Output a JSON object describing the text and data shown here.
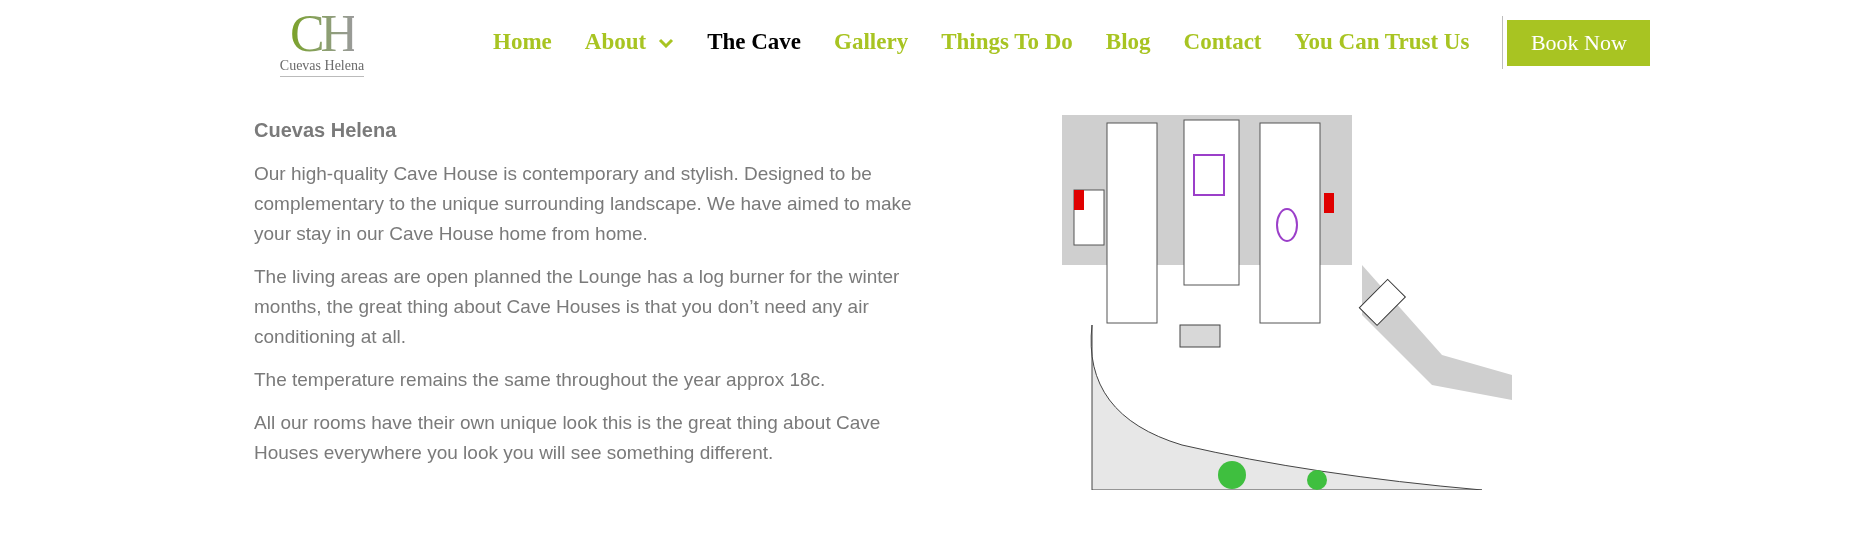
{
  "logo": {
    "initials": "CH",
    "name": "Cuevas Helena"
  },
  "nav": [
    {
      "label": "Home",
      "selected": false,
      "dropdown": false
    },
    {
      "label": "About",
      "selected": false,
      "dropdown": true
    },
    {
      "label": "The Cave",
      "selected": true,
      "dropdown": false
    },
    {
      "label": "Gallery",
      "selected": false,
      "dropdown": false
    },
    {
      "label": "Things To Do",
      "selected": false,
      "dropdown": false
    },
    {
      "label": "Blog",
      "selected": false,
      "dropdown": false
    },
    {
      "label": "Contact",
      "selected": false,
      "dropdown": false
    },
    {
      "label": "You Can Trust Us",
      "selected": false,
      "dropdown": false
    }
  ],
  "book_button": "Book Now",
  "content": {
    "heading": "Cuevas Helena",
    "paragraphs": [
      "Our high-quality Cave House is contemporary and stylish. Designed to be complementary to the unique surrounding landscape. We have aimed to make your stay in our Cave House home from home.",
      "The living areas are open planned the Lounge has a log burner for the winter months, the great thing about Cave Houses is that you don’t need any air conditioning at all.",
      "The temperature remains the same throughout the year approx 18c.",
      "All our rooms have their own unique look this is the great thing about Cave Houses everywhere you look you will see something different."
    ]
  }
}
